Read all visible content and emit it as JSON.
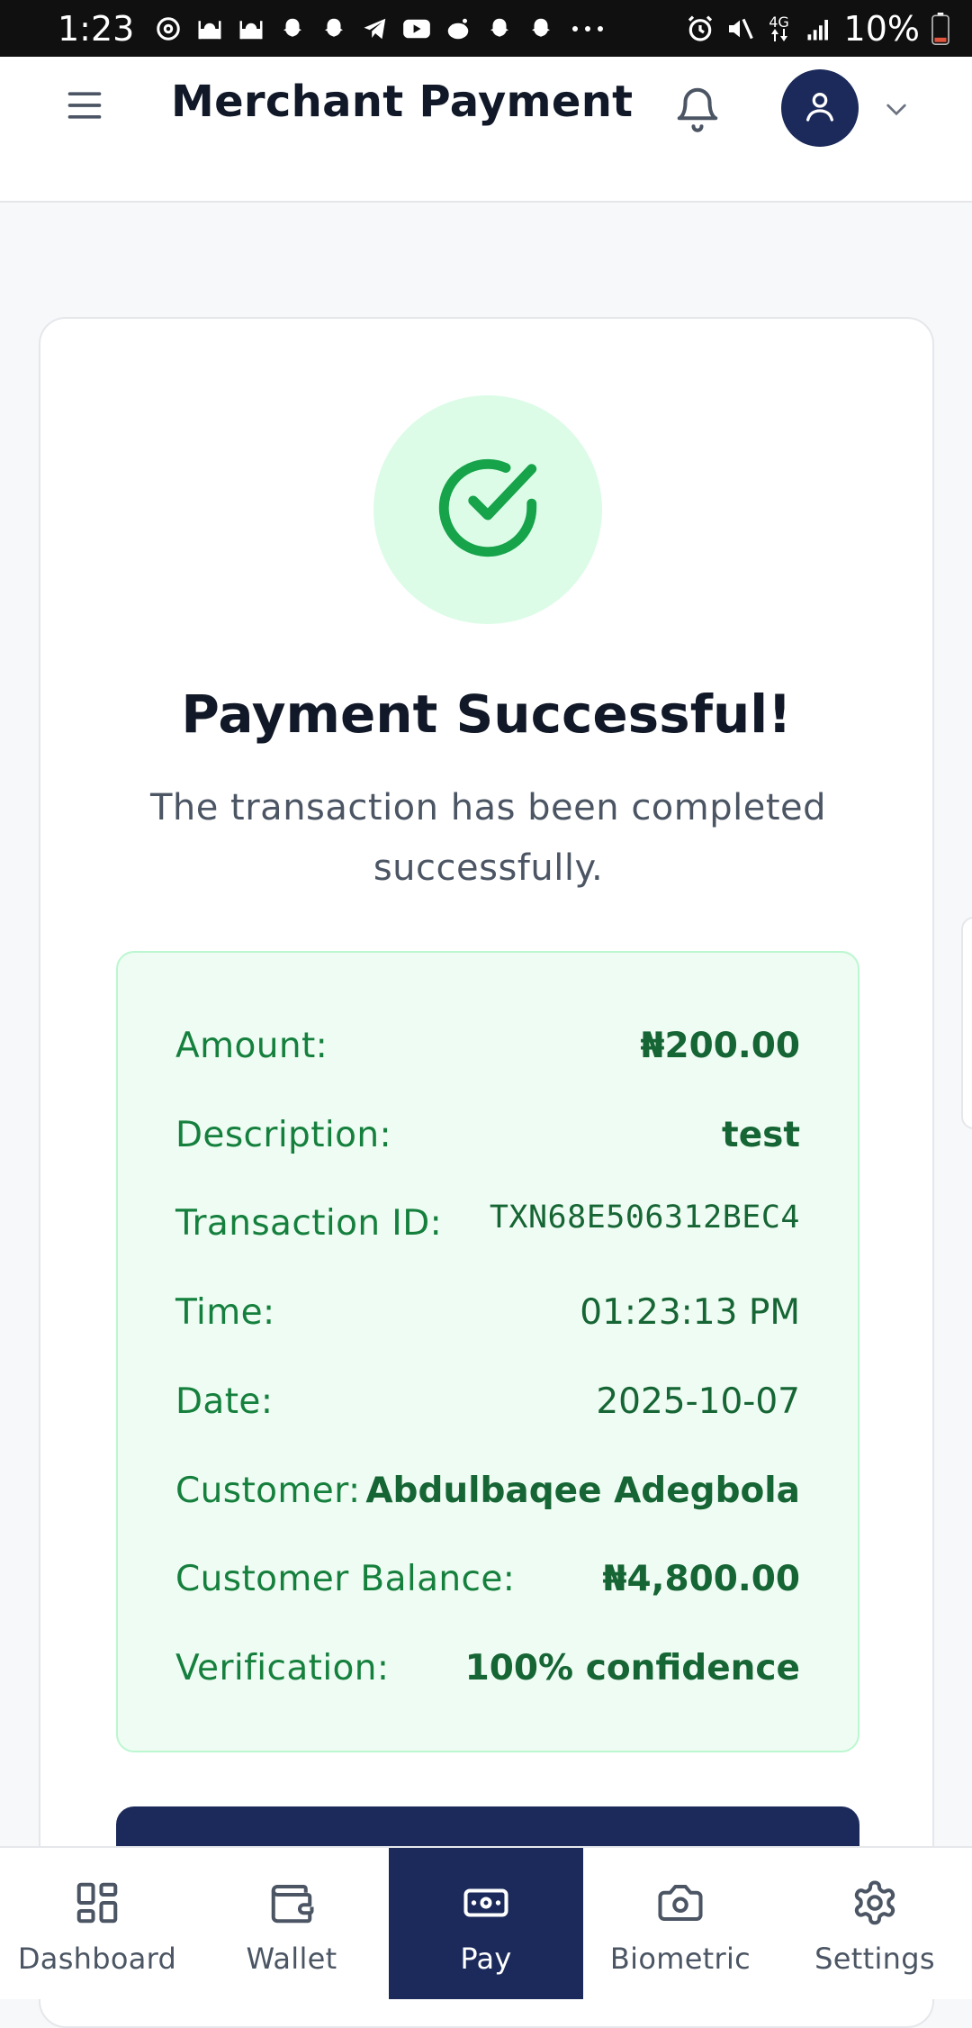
{
  "status_bar": {
    "time": "1:23",
    "battery": "10%",
    "network": "4G",
    "icons": [
      "sync-icon",
      "mosque-icon",
      "mosque-icon",
      "snapchat-icon",
      "snapchat-icon",
      "telegram-icon",
      "youtube-icon",
      "reddit-icon",
      "snapchat-icon",
      "snapchat-icon",
      "more-icon",
      "alarm-icon",
      "mute-icon",
      "network-icon",
      "signal-icon",
      "battery-icon"
    ]
  },
  "header": {
    "title": "Merchant Payment",
    "menu_icon": "hamburger-menu-icon",
    "bell_icon": "bell-icon",
    "avatar_icon": "user-icon",
    "dropdown_icon": "chevron-down-icon"
  },
  "result": {
    "icon": "check-circle-icon",
    "title": "Payment Successful!",
    "subtitle": "The transaction has been completed successfully."
  },
  "details": [
    {
      "label": "Amount:",
      "value": "₦200.00",
      "style": "bold"
    },
    {
      "label": "Description:",
      "value": "test",
      "style": "bold"
    },
    {
      "label": "Transaction ID:",
      "value": "TXN68E506312BEC4",
      "style": "mono"
    },
    {
      "label": "Time:",
      "value": "01:23:13 PM",
      "style": "normal"
    },
    {
      "label": "Date:",
      "value": "2025-10-07",
      "style": "normal"
    },
    {
      "label": "Customer:",
      "value": "Abdulbaqee Adegbola",
      "style": "bold"
    },
    {
      "label": "Customer Balance:",
      "value": "₦4,800.00",
      "style": "bold"
    },
    {
      "label": "Verification:",
      "value": "100% confidence",
      "style": "bold"
    }
  ],
  "bottom_nav": [
    {
      "label": "Dashboard",
      "icon": "dashboard-grid-icon",
      "active": false
    },
    {
      "label": "Wallet",
      "icon": "wallet-icon",
      "active": false
    },
    {
      "label": "Pay",
      "icon": "banknote-icon",
      "active": true
    },
    {
      "label": "Biometric",
      "icon": "camera-icon",
      "active": false
    },
    {
      "label": "Settings",
      "icon": "gear-icon",
      "active": false
    }
  ],
  "colors": {
    "primary": "#1b2a5a",
    "success": "#16a34a",
    "success_bg": "#dcfce7",
    "details_bg": "#effcf3",
    "details_text": "#166534"
  }
}
